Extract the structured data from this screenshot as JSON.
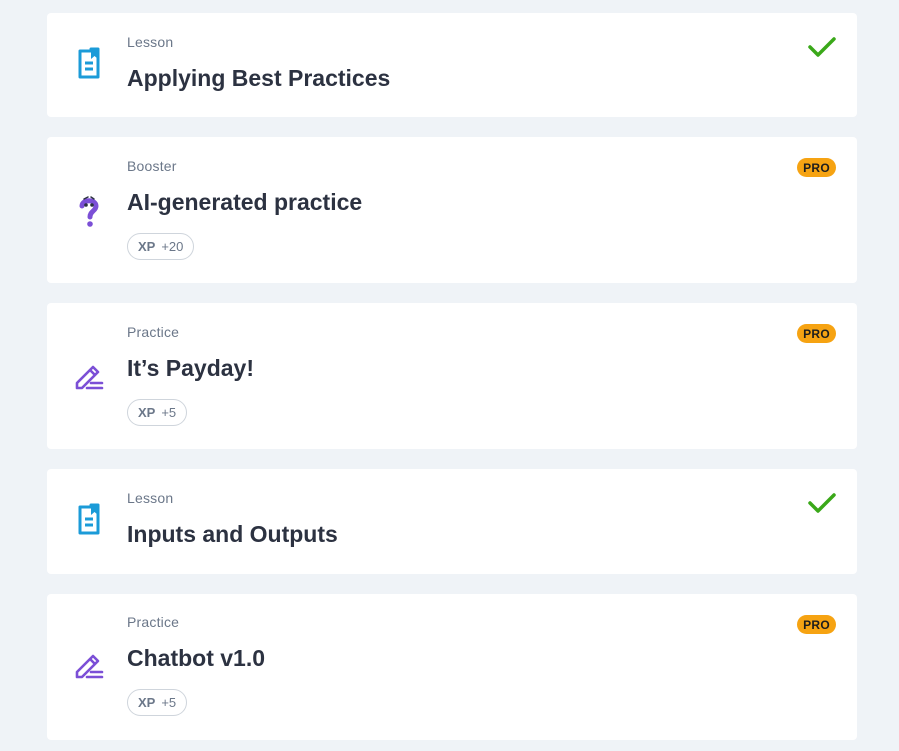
{
  "accent_colors": {
    "lesson_icon": "#1b9bd8",
    "practice_icon": "#7b4fd6",
    "check": "#3aa819",
    "pro_badge": "#f6a312"
  },
  "items": [
    {
      "kind": "Lesson",
      "title": "Applying Best Practices",
      "icon": "lesson-doc-icon",
      "completed": true
    },
    {
      "kind": "Booster",
      "title": "AI-generated practice",
      "icon": "question-mark-icon",
      "badge": "PRO",
      "xp_label": "XP",
      "xp_value": "+20"
    },
    {
      "kind": "Practice",
      "title": "It’s Payday!",
      "icon": "pencil-icon",
      "badge": "PRO",
      "xp_label": "XP",
      "xp_value": "+5"
    },
    {
      "kind": "Lesson",
      "title": "Inputs and Outputs",
      "icon": "lesson-doc-icon",
      "completed": true
    },
    {
      "kind": "Practice",
      "title": "Chatbot v1.0",
      "icon": "pencil-icon",
      "badge": "PRO",
      "xp_label": "XP",
      "xp_value": "+5"
    }
  ]
}
